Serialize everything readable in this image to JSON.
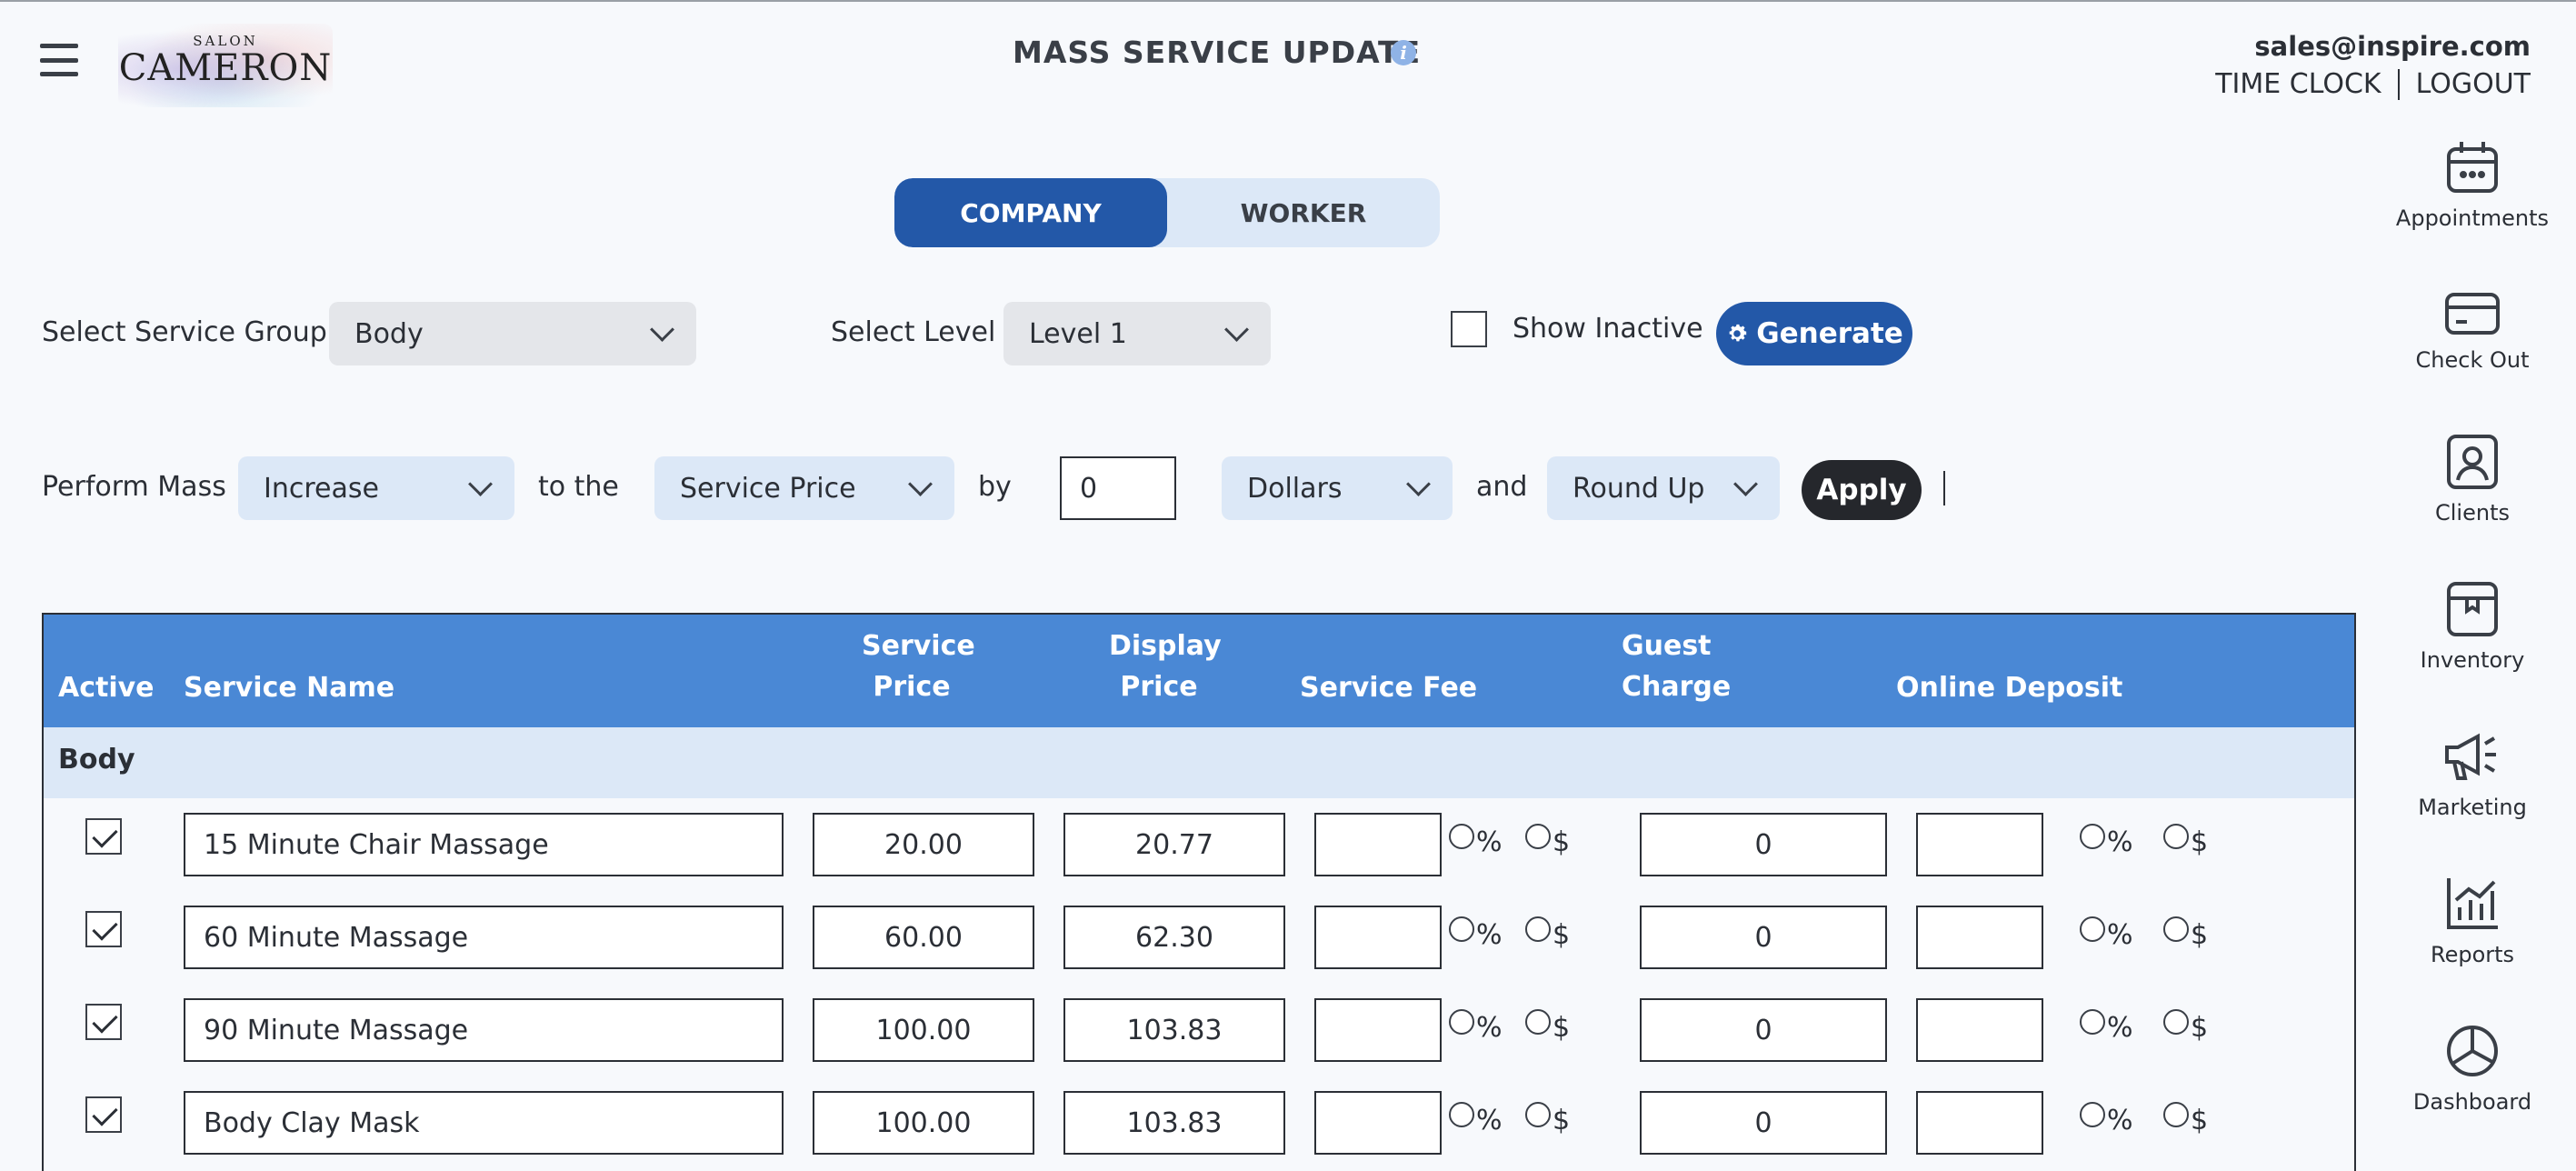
{
  "header": {
    "logo": {
      "small_text": "SALON",
      "big_text": "CAMERON"
    },
    "title": "MASS SERVICE UPDATE",
    "info_icon": "info-icon",
    "email": "sales@inspire.com",
    "time_clock": "TIME CLOCK",
    "logout": "LOGOUT"
  },
  "toggle": {
    "company": "COMPANY",
    "worker": "WORKER",
    "selected": "COMPANY"
  },
  "filters": {
    "service_group_label": "Select Service Group",
    "service_group_value": "Body",
    "level_label": "Select Level",
    "level_value": "Level 1",
    "show_inactive_label": "Show Inactive",
    "show_inactive_checked": false,
    "generate_label": "Generate",
    "generate_icon": "gear-icon"
  },
  "mass_update": {
    "perform_label": "Perform Mass",
    "action_value": "Increase",
    "to_the_label": "to the",
    "field_value": "Service Price",
    "by_label": "by",
    "amount_value": "0",
    "unit_value": "Dollars",
    "and_label": "and",
    "rounding_value": "Round Up",
    "apply_label": "Apply"
  },
  "table": {
    "headers": {
      "active": "Active",
      "service_name": "Service Name",
      "service_price_1": "Service",
      "service_price_2": "Price",
      "display_price_1": "Display",
      "display_price_2": "Price",
      "service_fee": "Service Fee",
      "guest_charge_1": "Guest",
      "guest_charge_2": "Charge",
      "online_deposit": "Online Deposit"
    },
    "group_name": "Body",
    "radio_percent": "%",
    "radio_dollar": "$",
    "rows": [
      {
        "active": true,
        "name": "15 Minute Chair Massage",
        "service_price": "20.00",
        "display_price": "20.77",
        "service_fee": "",
        "guest_charge": "0",
        "online_deposit": ""
      },
      {
        "active": true,
        "name": "60 Minute Massage",
        "service_price": "60.00",
        "display_price": "62.30",
        "service_fee": "",
        "guest_charge": "0",
        "online_deposit": ""
      },
      {
        "active": true,
        "name": "90 Minute Massage",
        "service_price": "100.00",
        "display_price": "103.83",
        "service_fee": "",
        "guest_charge": "0",
        "online_deposit": ""
      },
      {
        "active": true,
        "name": "Body Clay Mask",
        "service_price": "100.00",
        "display_price": "103.83",
        "service_fee": "",
        "guest_charge": "0",
        "online_deposit": ""
      }
    ]
  },
  "sidebar": {
    "items": [
      {
        "label": "Appointments",
        "icon": "calendar-icon"
      },
      {
        "label": "Check Out",
        "icon": "credit-card-icon"
      },
      {
        "label": "Clients",
        "icon": "client-badge-icon"
      },
      {
        "label": "Inventory",
        "icon": "inventory-box-icon"
      },
      {
        "label": "Marketing",
        "icon": "megaphone-icon"
      },
      {
        "label": "Reports",
        "icon": "bar-chart-icon"
      },
      {
        "label": "Dashboard",
        "icon": "pie-chart-icon"
      }
    ]
  }
}
